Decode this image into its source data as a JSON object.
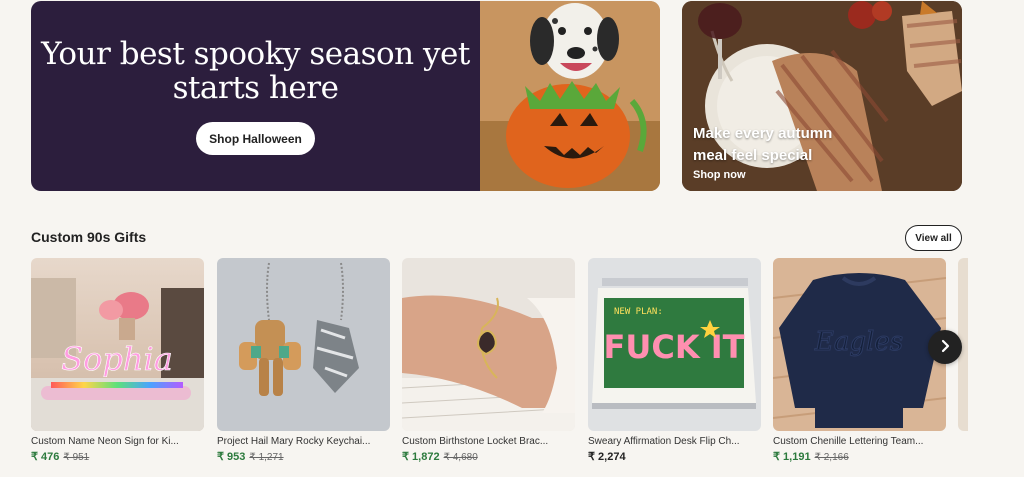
{
  "hero": {
    "headline": "Your best spooky season yet starts here",
    "cta_label": "Shop Halloween",
    "background": "#2c1e3d"
  },
  "promo": {
    "title": "Make every autumn meal feel special",
    "link_label": "Shop now"
  },
  "section": {
    "title": "Custom 90s Gifts",
    "view_all_label": "View all"
  },
  "products": [
    {
      "title": "Custom Name Neon Sign for Ki...",
      "price": "₹ 476",
      "old_price": "₹ 951",
      "image": "neon-sign-image",
      "neon_text": "Sophia"
    },
    {
      "title": "Project Hail Mary Rocky Keychai...",
      "price": "₹ 953",
      "old_price": "₹ 1,271",
      "image": "keychain-image"
    },
    {
      "title": "Custom Birthstone Locket Brac...",
      "price": "₹ 1,872",
      "old_price": "₹ 4,680",
      "image": "bracelet-image"
    },
    {
      "title": "Sweary Affirmation Desk Flip Ch...",
      "price": "₹ 2,274",
      "old_price": "",
      "image": "desk-calendar-image",
      "calendar_header": "NEW PLAN:",
      "calendar_word": "FUCK IT"
    },
    {
      "title": "Custom Chenille Lettering Team...",
      "price": "₹ 1,191",
      "old_price": "₹ 2,166",
      "image": "sweatshirt-image",
      "shirt_text": "Eagles"
    }
  ],
  "carousel": {
    "next_icon": "chevron-right-icon"
  },
  "colors": {
    "sale_price": "#2c7a3d",
    "button_dark": "#222222"
  }
}
